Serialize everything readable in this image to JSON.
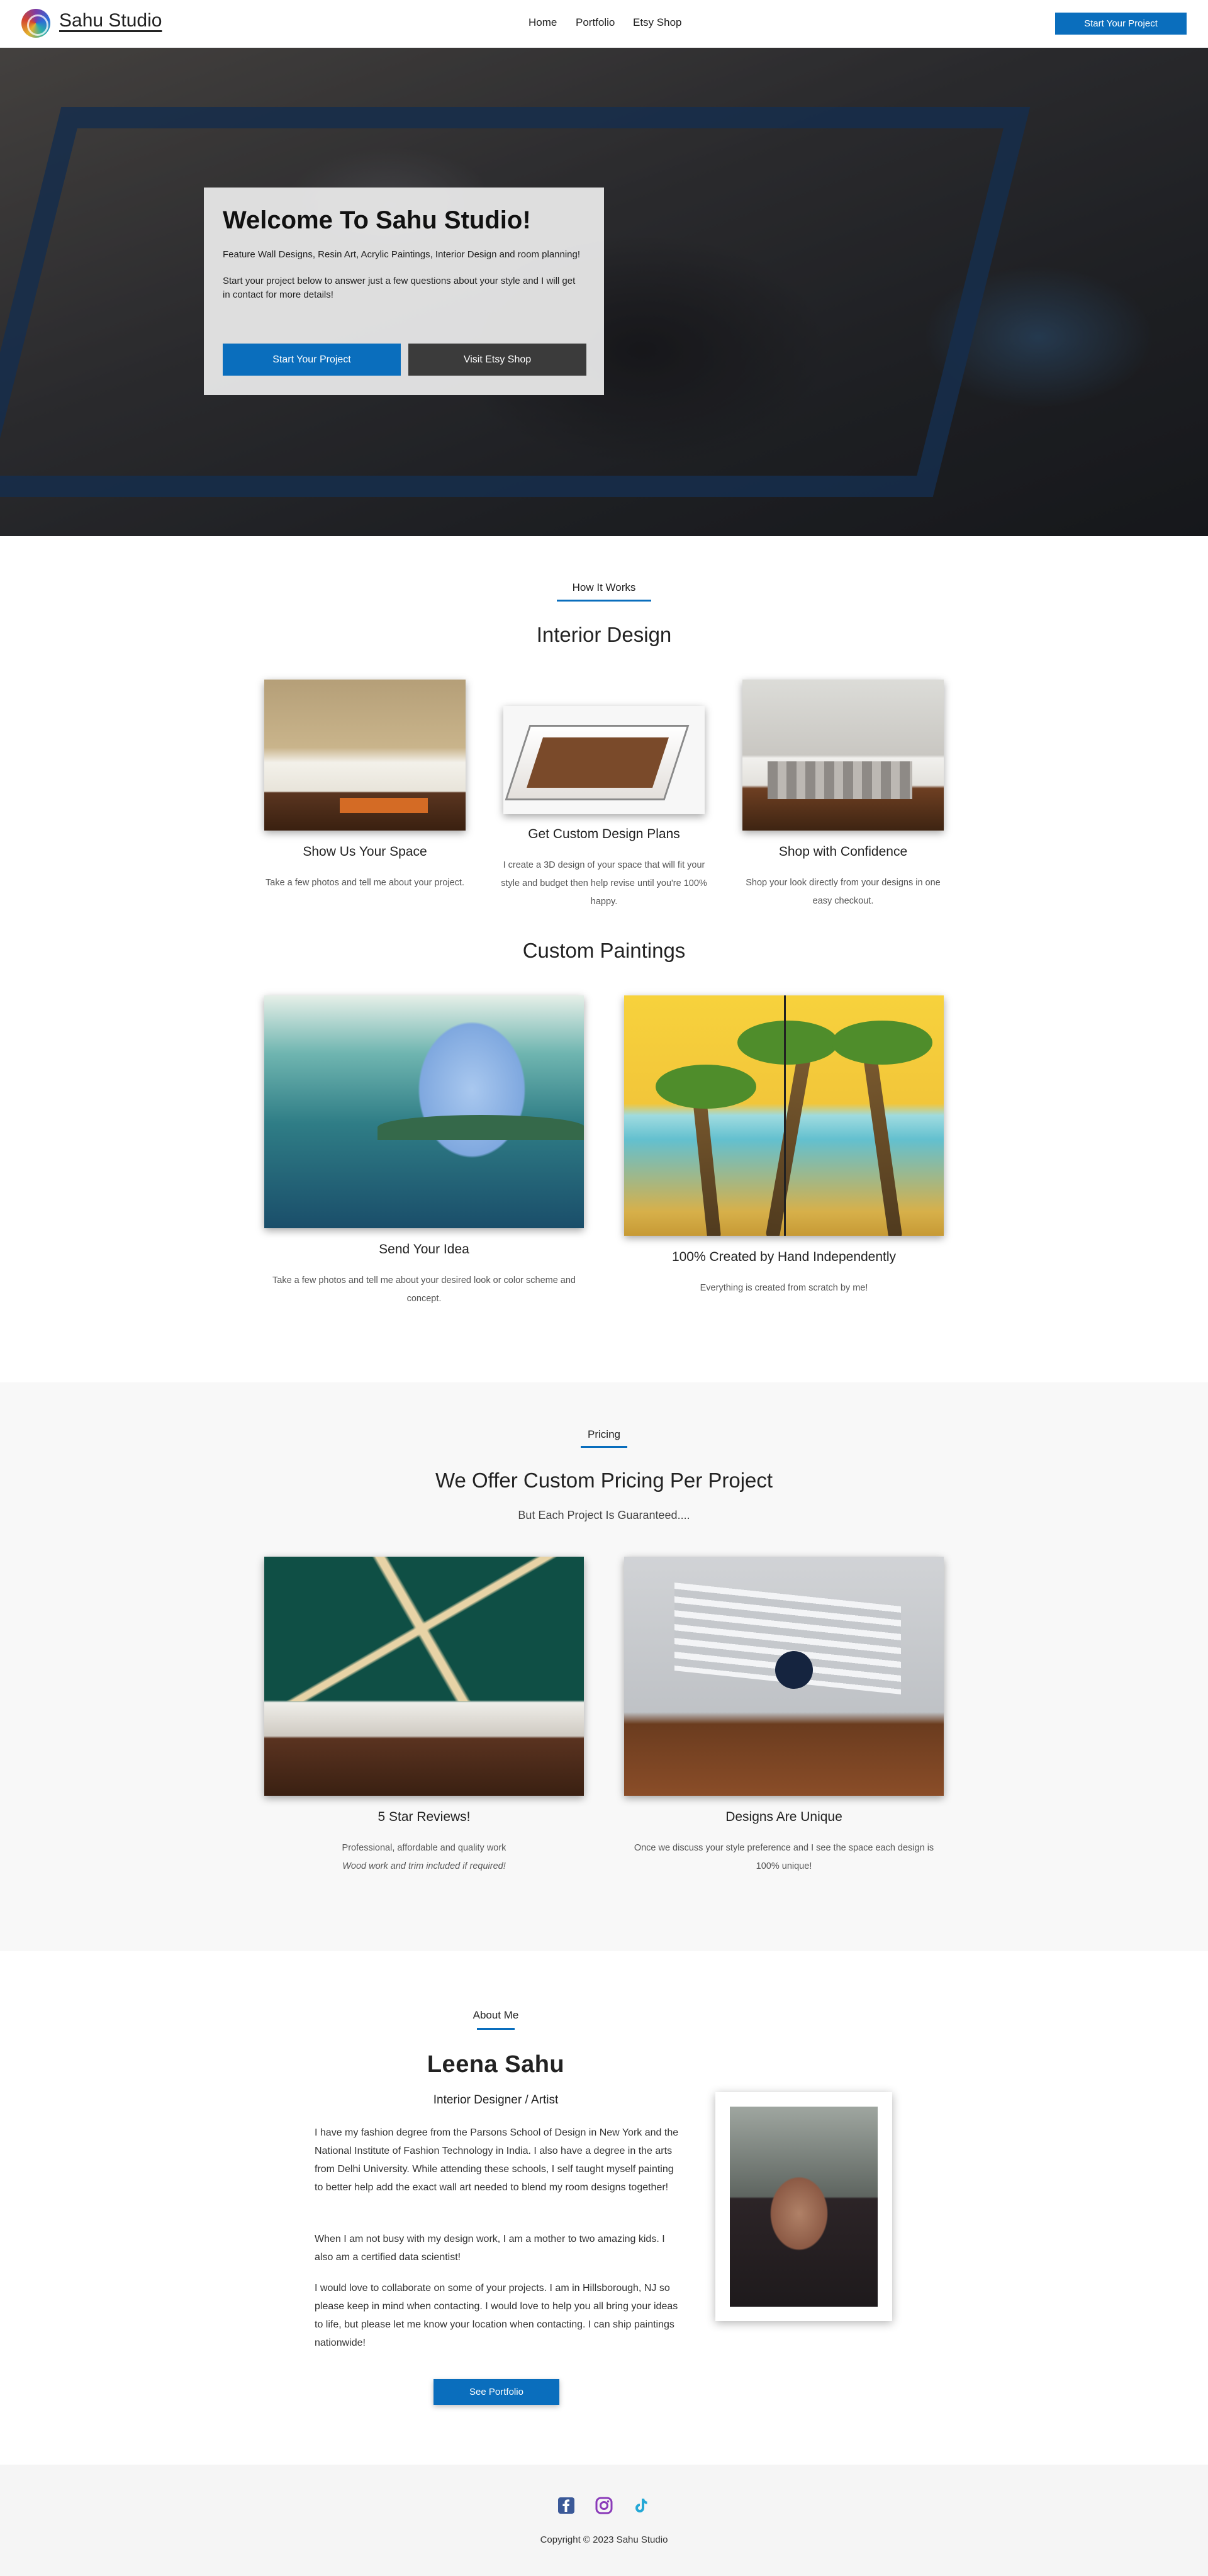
{
  "header": {
    "brand": "Sahu Studio",
    "nav": [
      "Home",
      "Portfolio",
      "Etsy Shop"
    ],
    "cta": "Start Your Project"
  },
  "hero": {
    "title": "Welcome To Sahu Studio!",
    "paragraph1": "Feature Wall Designs, Resin Art, Acrylic Paintings, Interior Design and room planning!",
    "paragraph2": "Start your project below to answer just a few questions about your style and I will get in contact for more details!",
    "primary_button": "Start Your Project",
    "secondary_button": "Visit Etsy Shop"
  },
  "how_it_works": {
    "label": "How It Works",
    "interior_title": "Interior Design",
    "steps": [
      {
        "title": "Show Us Your Space",
        "text": "Take a few photos and tell me about your project."
      },
      {
        "title": "Get Custom Design Plans",
        "text": "I create a 3D design of your space that will fit your style and budget then help revise until you're 100% happy."
      },
      {
        "title": "Shop with Confidence",
        "text": "Shop your look directly from your designs in one easy checkout."
      }
    ],
    "paintings_title": "Custom Paintings",
    "paintings": [
      {
        "title": "Send Your Idea",
        "text": "Take a few photos and tell me about your desired look or color scheme and concept."
      },
      {
        "title": "100% Created by Hand Independently",
        "text": "Everything is created from scratch by me!"
      }
    ]
  },
  "pricing": {
    "label": "Pricing",
    "title": "We Offer Custom Pricing Per Project",
    "subtitle": "But Each Project Is Guaranteed....",
    "cards": [
      {
        "title": "5 Star Reviews!",
        "text": "Professional, affordable and quality work",
        "note": "Wood work and trim included if required!"
      },
      {
        "title": "Designs Are Unique",
        "text": "Once we discuss your style preference and I see the space each design is 100% unique!"
      }
    ]
  },
  "about": {
    "label": "About Me",
    "name": "Leena Sahu",
    "role": "Interior Designer / Artist",
    "paragraphs": [
      "I have my fashion degree from the Parsons School of Design in New York and the National Institute of Fashion Technology in India. I also have a degree in the arts from Delhi University. While attending these schools, I self taught myself painting to better help add the exact wall art needed to blend my room designs together!",
      "When I am not busy with my design work, I am a mother to two amazing kids. I also am a certified data scientist!",
      "I would love to collaborate on some of your projects. I am in Hillsborough, NJ so please keep in mind when contacting. I would love to help you all bring your ideas to life, but please let me know your location when contacting. I can ship paintings nationwide!"
    ],
    "button": "See Portfolio"
  },
  "footer": {
    "social_icons": [
      "facebook-icon",
      "instagram-icon",
      "tiktok-icon"
    ],
    "copyright": "Copyright © 2023 Sahu Studio"
  },
  "colors": {
    "accent": "#0a6ebd",
    "dark_button": "#3b3b3b",
    "facebook": "#3b5998",
    "instagram": "#8a3ab9",
    "tiktok": "#25a8d6"
  }
}
